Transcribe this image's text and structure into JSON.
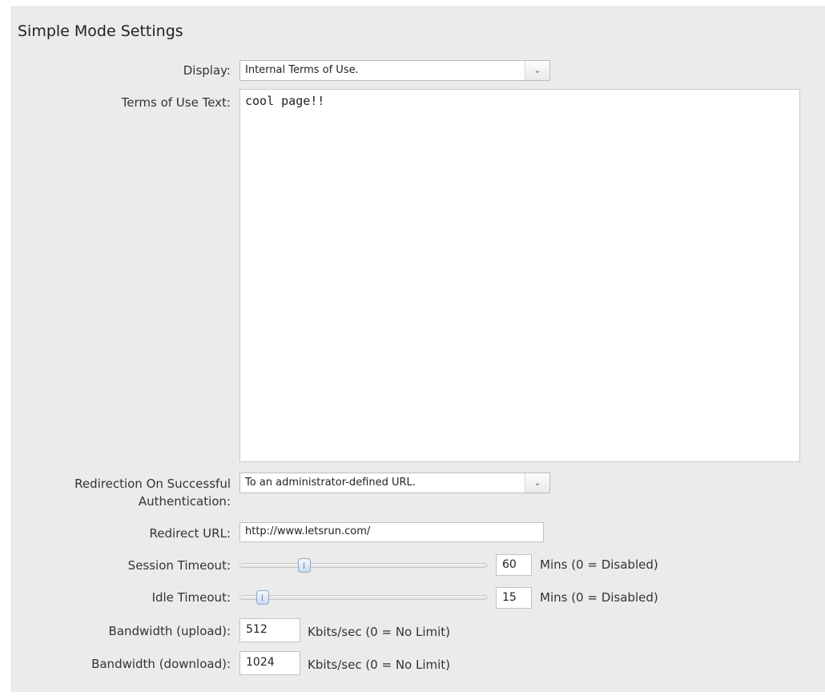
{
  "section": {
    "title": "Simple Mode Settings"
  },
  "display": {
    "label": "Display:",
    "selected": "Internal Terms of Use."
  },
  "terms": {
    "label": "Terms of Use Text:",
    "value": "cool page!!"
  },
  "redirection": {
    "label": "Redirection On Successful Authentication:",
    "selected": "To an administrator-defined URL."
  },
  "redirect_url": {
    "label": "Redirect URL:",
    "value": "http://www.letsrun.com/"
  },
  "session_timeout": {
    "label": "Session Timeout:",
    "value": "60",
    "unit": "Mins (0 = Disabled)"
  },
  "idle_timeout": {
    "label": "Idle Timeout:",
    "value": "15",
    "unit": "Mins (0 = Disabled)"
  },
  "bandwidth_upload": {
    "label": "Bandwidth (upload):",
    "value": "512",
    "unit": "Kbits/sec (0 = No Limit)"
  },
  "bandwidth_download": {
    "label": "Bandwidth (download):",
    "value": "1024",
    "unit": "Kbits/sec (0 = No Limit)"
  },
  "icons": {
    "dropdown": "chevron-down-icon"
  }
}
